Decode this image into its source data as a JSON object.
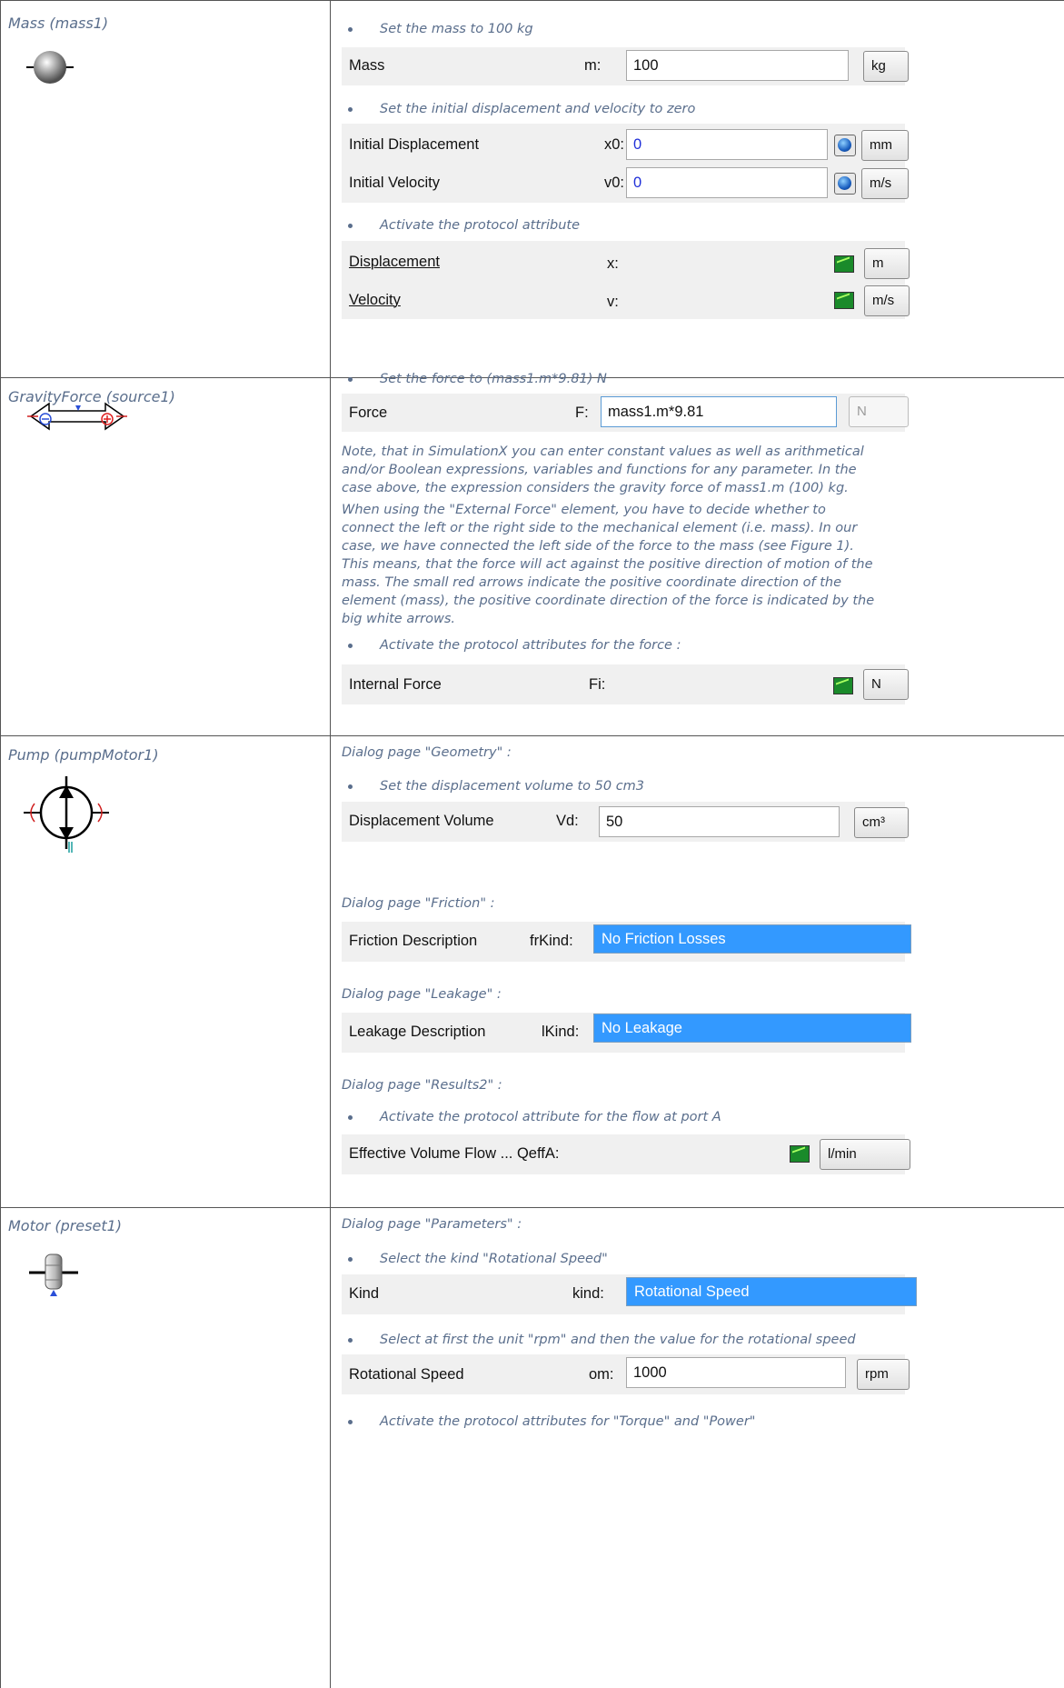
{
  "rows": [
    {
      "title": "Mass (mass1)",
      "items": {
        "b1": "Set the mass to 100 kg",
        "mass_label": "Mass",
        "mass_var": "m:",
        "mass_value": "100",
        "mass_unit": "kg",
        "b2": "Set the initial displacement and velocity to zero",
        "x0_label": "Initial Displacement",
        "x0_var": "x0:",
        "x0_value": "0",
        "x0_unit": "mm",
        "v0_label": "Initial Velocity",
        "v0_var": "v0:",
        "v0_value": "0",
        "v0_unit": "m/s",
        "b3": "Activate the protocol attribute",
        "disp_label": "Displacement",
        "disp_var": "x:",
        "disp_unit": "m",
        "vel_label": "Velocity",
        "vel_var": "v:",
        "vel_unit": "m/s"
      }
    },
    {
      "title": "GravityForce (source1)",
      "items": {
        "b1": "Set the force to (mass1.m*9.81) N",
        "force_label": "Force",
        "force_var": "F:",
        "force_value": "mass1.m*9.81",
        "force_unit": "N",
        "note1": "Note, that in SimulationX you can enter constant values as well as arithmetical and/or Boolean expressions, variables and functions for any parameter. In the case above, the expression considers the gravity force of mass1.m (100) kg.",
        "note2": "When using the \"External Force\" element, you have to decide whether to connect the left or the right side to the mechanical element (i.e. mass). In our case, we have connected the left side of the force to the mass (see Figure 1). This means, that the force will act against the positive direction of motion of the mass. The small red arrows indicate the positive coordinate direction of the element (mass), the positive coordinate direction of the force is indicated by the big white arrows.",
        "b2": "Activate the protocol attributes for the force :",
        "fi_label": "Internal Force",
        "fi_var": "Fi:",
        "fi_unit": "N"
      }
    },
    {
      "title": "Pump (pumpMotor1)",
      "items": {
        "d1": "Dialog page \"Geometry\" :",
        "b1": "Set the displacement volume to 50 cm3",
        "vd_label": "Displacement Volume",
        "vd_var": "Vd:",
        "vd_value": "50",
        "vd_unit": "cm³",
        "d2": "Dialog page \"Friction\" :",
        "fr_label": "Friction Description",
        "fr_var": "frKind:",
        "fr_value": "No Friction Losses",
        "d3": "Dialog page \"Leakage\" :",
        "lk_label": "Leakage Description",
        "lk_var": "lKind:",
        "lk_value": "No Leakage",
        "d4": "Dialog page \"Results2\" :",
        "b2": "Activate the protocol attribute for the flow at port A",
        "q_label": "Effective Volume Flow ... QeffA:",
        "q_unit": "l/min"
      }
    },
    {
      "title": "Motor (preset1)",
      "items": {
        "d1": "Dialog page \"Parameters\" :",
        "b1": "Select the kind \"Rotational Speed\"",
        "kind_label": "Kind",
        "kind_var": "kind:",
        "kind_value": "Rotational Speed",
        "b2": "Select at first the unit \"rpm\" and then the value for the rotational speed",
        "om_label": "Rotational Speed",
        "om_var": "om:",
        "om_value": "1000",
        "om_unit": "rpm",
        "b3": "Activate the protocol attributes for \"Torque\" and \"Power\""
      }
    }
  ]
}
